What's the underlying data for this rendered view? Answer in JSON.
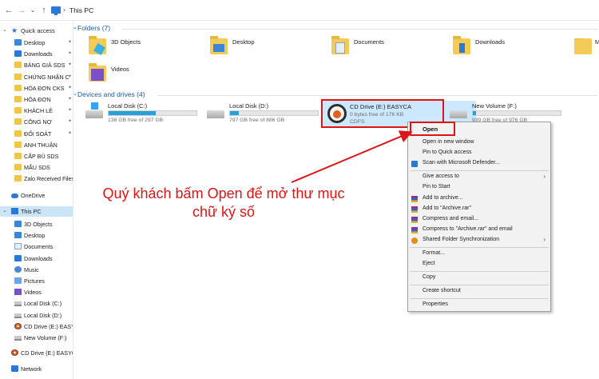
{
  "address_bar": {
    "back": "←",
    "forward": "→",
    "recent": "⌄",
    "up": "↑",
    "separator": "›",
    "path": "This PC"
  },
  "sidebar": {
    "quick_access": "Quick access",
    "quick_items": [
      {
        "label": "Desktop",
        "icon": "desktop-icon"
      },
      {
        "label": "Downloads",
        "icon": "downloads-icon"
      },
      {
        "label": "BẢNG GIÁ SDS",
        "icon": "folder-icon"
      },
      {
        "label": "CHỨNG NHẬN C",
        "icon": "folder-icon"
      },
      {
        "label": "HÓA ĐƠN CKS",
        "icon": "folder-icon"
      },
      {
        "label": "HÓA ĐƠN",
        "icon": "folder-icon"
      },
      {
        "label": "KHÁCH LẺ",
        "icon": "folder-icon"
      },
      {
        "label": "CÔNG NỢ",
        "icon": "folder-icon"
      },
      {
        "label": "ĐỐI SOÁT",
        "icon": "folder-icon"
      },
      {
        "label": "ANH THUẬN",
        "icon": "folder-icon"
      },
      {
        "label": "CẤP BÙ SDS",
        "icon": "folder-icon"
      },
      {
        "label": "MẪU SDS",
        "icon": "folder-icon"
      },
      {
        "label": "Zalo Received Files",
        "icon": "folder-icon"
      }
    ],
    "onedrive": "OneDrive",
    "this_pc": "This PC",
    "pc_items": [
      {
        "label": "3D Objects",
        "icon": "3d-objects-icon"
      },
      {
        "label": "Desktop",
        "icon": "desktop-icon"
      },
      {
        "label": "Documents",
        "icon": "documents-icon"
      },
      {
        "label": "Downloads",
        "icon": "downloads-icon"
      },
      {
        "label": "Music",
        "icon": "music-icon"
      },
      {
        "label": "Pictures",
        "icon": "pictures-icon"
      },
      {
        "label": "Videos",
        "icon": "videos-icon"
      },
      {
        "label": "Local Disk (C:)",
        "icon": "drive-icon"
      },
      {
        "label": "Local Disk (D:)",
        "icon": "drive-icon"
      },
      {
        "label": "CD Drive (E:) EASYC",
        "icon": "cd-drive-icon"
      },
      {
        "label": "New Volume (F:)",
        "icon": "drive-icon"
      }
    ],
    "cd_drive": "CD Drive (E:) EASYCA",
    "network": "Network"
  },
  "main": {
    "folders_header": "Folders (7)",
    "folders": [
      "3D Objects",
      "Desktop",
      "Documents",
      "Downloads",
      "M",
      "Videos"
    ],
    "devices_header": "Devices and drives (4)",
    "drives": [
      {
        "name": "Local Disk (C:)",
        "free": "138 GB free of 297 GB",
        "used_fraction": 0.54
      },
      {
        "name": "Local Disk (D:)",
        "free": "797 GB free of 886 GB",
        "used_fraction": 0.1
      },
      {
        "name": "New Volume (F:)",
        "free": "939 GB free of 976 GB",
        "used_fraction": 0.04
      }
    ],
    "cd_drive": {
      "name": "CD Drive (E:) EASYCA",
      "free": "0 bytes free of 176 KB",
      "fs": "CDFS"
    }
  },
  "context_menu": {
    "open": "Open",
    "items": [
      {
        "label": "Open in new window"
      },
      {
        "label": "Pin to Quick access"
      },
      {
        "label": "Scan with Microsoft Defender...",
        "icon": "defender-icon"
      },
      {
        "sep": true
      },
      {
        "label": "Give access to",
        "sub": "›"
      },
      {
        "label": "Pin to Start"
      },
      {
        "label": "Add to archive...",
        "icon": "winrar-icon"
      },
      {
        "label": "Add to \"Archive.rar\"",
        "icon": "winrar-icon"
      },
      {
        "label": "Compress and email...",
        "icon": "winrar-icon"
      },
      {
        "label": "Compress to \"Archive.rar\" and email",
        "icon": "winrar-icon"
      },
      {
        "label": "Shared Folder Synchronization",
        "icon": "sync-icon",
        "sub": "›"
      },
      {
        "sep": true
      },
      {
        "label": "Format..."
      },
      {
        "label": "Eject"
      },
      {
        "sep": true
      },
      {
        "label": "Copy"
      },
      {
        "sep": true
      },
      {
        "label": "Create shortcut"
      },
      {
        "sep": true
      },
      {
        "label": "Properties"
      }
    ]
  },
  "annotation": {
    "line1": "Quý khách bấm Open để mở thư mục",
    "line2": "chữ ký số",
    "color": "#e01414"
  }
}
